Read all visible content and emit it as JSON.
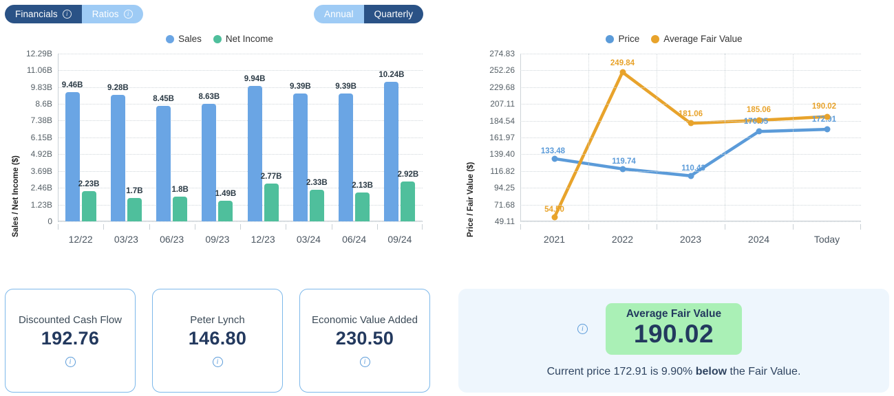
{
  "toggles": {
    "left_group": [
      {
        "label": "Financials",
        "state": "active",
        "info_icon": "info-icon"
      },
      {
        "label": "Ratios",
        "state": "inactive",
        "info_icon": "info-icon"
      }
    ],
    "period_group": [
      {
        "label": "Annual",
        "state": "inactive"
      },
      {
        "label": "Quarterly",
        "state": "active"
      }
    ]
  },
  "colors": {
    "sales": "#6aa5e4",
    "net_income": "#4fbf9c",
    "price": "#5b9bd9",
    "fair_value": "#e8a32b",
    "pill_dark": "#2a5286",
    "pill_light": "#9ecbf5",
    "fv_box_bg": "#aaf0b6",
    "fv_panel_bg": "#eef6fd",
    "value_text": "#23395e"
  },
  "chart_data": [
    {
      "type": "bar",
      "id": "financials-bar-chart",
      "title": "",
      "xlabel": "",
      "ylabel": "Sales / Net Income ($)",
      "categories": [
        "12/22",
        "03/23",
        "06/23",
        "09/23",
        "12/23",
        "03/24",
        "06/24",
        "09/24"
      ],
      "ytick_labels": [
        "12.29B",
        "11.06B",
        "9.83B",
        "8.6B",
        "7.38B",
        "6.15B",
        "4.92B",
        "3.69B",
        "2.46B",
        "1.23B",
        "0"
      ],
      "ytick_values": [
        12.29,
        11.06,
        9.83,
        8.6,
        7.38,
        6.15,
        4.92,
        3.69,
        2.46,
        1.23,
        0
      ],
      "ylim": [
        0,
        12.29
      ],
      "grid": true,
      "legend_position": "top-center",
      "series": [
        {
          "name": "Sales",
          "color": "#6aa5e4",
          "values": [
            9.46,
            9.28,
            8.45,
            8.63,
            9.94,
            9.39,
            9.39,
            10.24
          ],
          "labels": [
            "9.46B",
            "9.28B",
            "8.45B",
            "8.63B",
            "9.94B",
            "9.39B",
            "9.39B",
            "10.24B"
          ]
        },
        {
          "name": "Net Income",
          "color": "#4fbf9c",
          "values": [
            2.23,
            1.7,
            1.8,
            1.49,
            2.77,
            2.33,
            2.13,
            2.92
          ],
          "labels": [
            "2.23B",
            "1.7B",
            "1.8B",
            "1.49B",
            "2.77B",
            "2.33B",
            "2.13B",
            "2.92B"
          ]
        }
      ]
    },
    {
      "type": "line",
      "id": "price-fair-value-chart",
      "title": "",
      "xlabel": "",
      "ylabel": "Price / Fair Value ($)",
      "categories": [
        "2021",
        "2022",
        "2023",
        "2024",
        "Today"
      ],
      "ytick_labels": [
        "274.83",
        "252.26",
        "229.68",
        "207.11",
        "184.54",
        "161.97",
        "139.40",
        "116.82",
        "94.25",
        "71.68",
        "49.11"
      ],
      "ytick_values": [
        274.83,
        252.26,
        229.68,
        207.11,
        184.54,
        161.97,
        139.4,
        116.82,
        94.25,
        71.68,
        49.11
      ],
      "ylim": [
        49.11,
        274.83
      ],
      "grid": true,
      "legend_position": "top-center",
      "series": [
        {
          "name": "Price",
          "color": "#5b9bd9",
          "values": [
            133.48,
            119.74,
            110.43,
            170.05,
            172.91
          ],
          "labels": [
            "133.48",
            "119.74",
            "110.43",
            "170.05",
            "172.91"
          ]
        },
        {
          "name": "Average Fair Value",
          "color": "#e8a32b",
          "values": [
            54.5,
            249.84,
            181.06,
            185.06,
            190.02
          ],
          "labels": [
            "54.50",
            "249.84",
            "181.06",
            "185.06",
            "190.02"
          ]
        }
      ]
    }
  ],
  "valuation_cards": [
    {
      "title": "Discounted Cash Flow",
      "value": "192.76",
      "info_icon": "info-icon"
    },
    {
      "title": "Peter Lynch",
      "value": "146.80",
      "info_icon": "info-icon"
    },
    {
      "title": "Economic Value Added",
      "value": "230.50",
      "info_icon": "info-icon"
    }
  ],
  "fair_value_panel": {
    "info_icon": "info-icon",
    "box_title": "Average Fair Value",
    "box_value": "190.02",
    "caption_before": "Current price 172.91 is 9.90% ",
    "caption_emphasis": "below",
    "caption_after": " the Fair Value."
  }
}
